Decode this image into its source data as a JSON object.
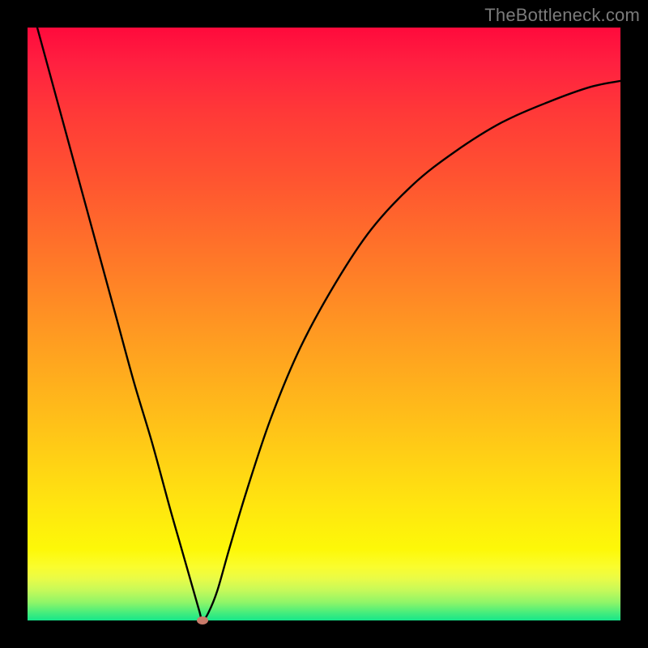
{
  "watermark": "TheBottleneck.com",
  "colors": {
    "background": "#000000",
    "curve": "#000000",
    "min_marker": "#c97b6a"
  },
  "chart_data": {
    "type": "line",
    "title": "",
    "xlabel": "",
    "ylabel": "",
    "xlim": [
      0,
      100
    ],
    "ylim": [
      0,
      100
    ],
    "grid": false,
    "annotations": [
      {
        "text": "TheBottleneck.com",
        "position": "top-right"
      }
    ],
    "min_point": {
      "x": 29.5,
      "y": 0
    },
    "series": [
      {
        "name": "bottleneck-curve",
        "x": [
          0,
          3,
          6,
          9,
          12,
          15,
          18,
          21,
          24,
          26,
          28,
          29,
          29.5,
          30.5,
          32,
          34,
          37,
          41,
          46,
          52,
          58,
          65,
          72,
          80,
          88,
          95,
          100
        ],
        "y": [
          106,
          95,
          84,
          73,
          62,
          51,
          40,
          30,
          19,
          12,
          5,
          1.5,
          0,
          1.3,
          5,
          12,
          22,
          34,
          46,
          57,
          66,
          73.5,
          79,
          84,
          87.5,
          90,
          91
        ]
      }
    ],
    "background_gradient": {
      "direction": "vertical",
      "stops": [
        {
          "pos": 0.0,
          "color": "#ff0a3c"
        },
        {
          "pos": 0.4,
          "color": "#ff7a28"
        },
        {
          "pos": 0.8,
          "color": "#ffe410"
        },
        {
          "pos": 0.93,
          "color": "#e8fb48"
        },
        {
          "pos": 1.0,
          "color": "#16e68a"
        }
      ]
    }
  }
}
